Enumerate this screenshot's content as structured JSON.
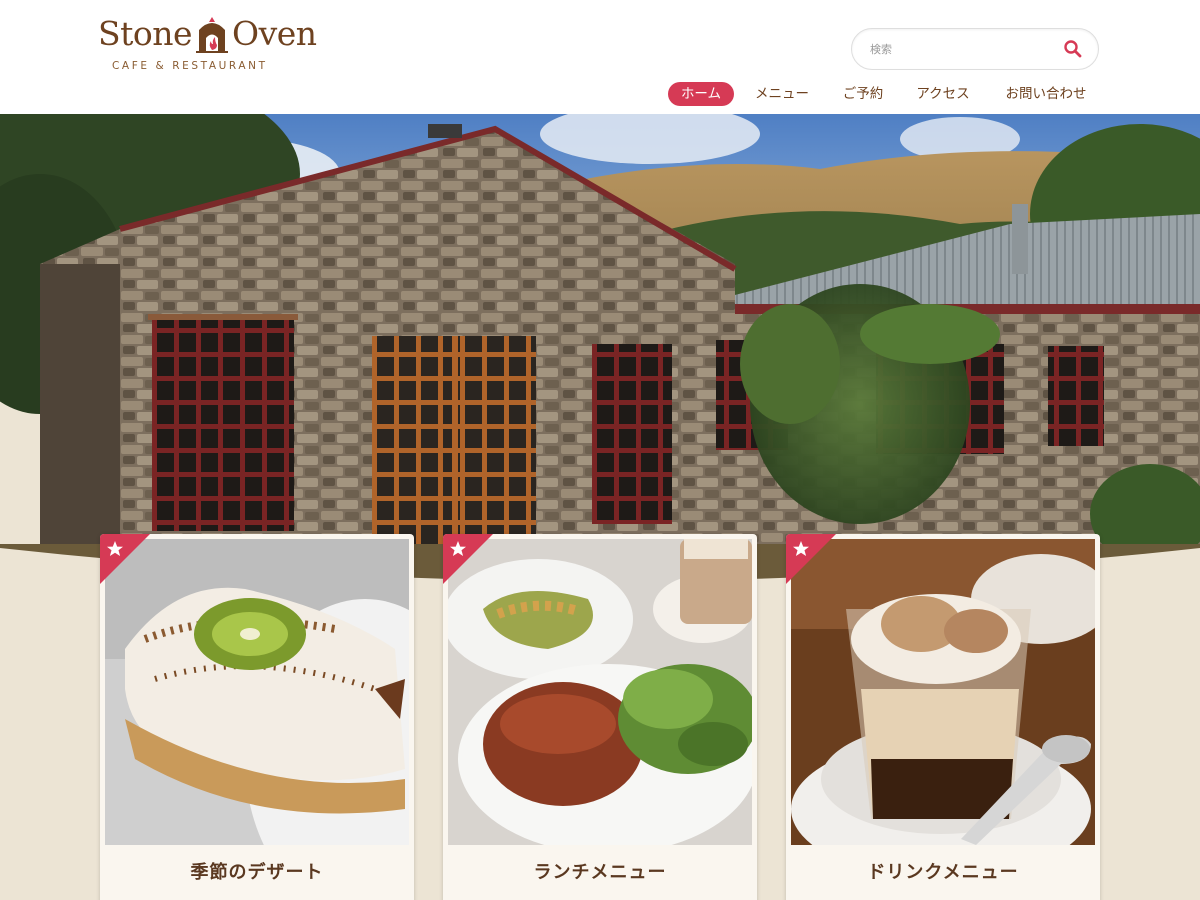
{
  "brand": {
    "name_left": "Stone",
    "name_right": "Oven",
    "tagline": "CAFE & RESTAURANT"
  },
  "search": {
    "placeholder": "検索",
    "icon": "search-icon"
  },
  "nav": {
    "items": [
      {
        "label": "ホーム",
        "active": true
      },
      {
        "label": "メニュー",
        "active": false
      },
      {
        "label": "ご予約",
        "active": false
      },
      {
        "label": "アクセス",
        "active": false
      },
      {
        "label": "お問い合わせ",
        "active": false
      }
    ]
  },
  "cards": [
    {
      "title": "季節のデザート",
      "badge_icon": "star-icon"
    },
    {
      "title": "ランチメニュー",
      "badge_icon": "star-icon"
    },
    {
      "title": "ドリンクメニュー",
      "badge_icon": "star-icon"
    }
  ],
  "colors": {
    "accent": "#d63a55",
    "brand_brown": "#6e4220",
    "background": "#ece4d4",
    "card_bg": "#faf6ef"
  }
}
